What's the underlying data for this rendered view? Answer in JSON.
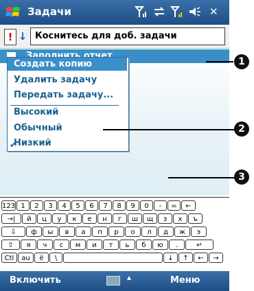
{
  "header": {
    "title": "Задачи",
    "signal_icon": "signal-icon",
    "sync_icon": "sync-icon",
    "volume_icon": "speaker-icon",
    "close_label": "✕"
  },
  "entry": {
    "priority_high": "!",
    "priority_low": "↓",
    "placeholder": "Коснитесь для доб. задачи"
  },
  "task": {
    "title": "Заполнить отчет"
  },
  "context_menu": {
    "items": [
      "Создать копию",
      "Удалить задачу",
      "Передать задачу..."
    ],
    "priorities": [
      "Высокий",
      "Обычный",
      "Низкий"
    ],
    "selected_priority": "Низкий"
  },
  "callouts": [
    "1",
    "2",
    "3"
  ],
  "keyboard": {
    "row1": [
      "123",
      "1",
      "2",
      "3",
      "4",
      "5",
      "6",
      "7",
      "8",
      "9",
      "0",
      "-",
      "=",
      "←"
    ],
    "row2": [
      "→|",
      "й",
      "ц",
      "у",
      "к",
      "е",
      "н",
      "г",
      "ш",
      "щ",
      "з",
      "х",
      "ъ"
    ],
    "row3": [
      "⇩",
      "ф",
      "ы",
      "в",
      "а",
      "п",
      "р",
      "о",
      "л",
      "д",
      "ж",
      "э"
    ],
    "row4": [
      "⇧",
      "я",
      "ч",
      "с",
      "м",
      "и",
      "т",
      "ь",
      "б",
      "ю",
      ".",
      "↵"
    ],
    "row5": [
      "Ctl",
      "аu",
      "ё",
      "\\",
      "",
      "↓",
      "↑",
      "←",
      "→"
    ]
  },
  "bottom": {
    "left": "Включить",
    "right": "Меню"
  },
  "colors": {
    "titlebar": "#1e4f85",
    "selection": "#3a8fc8",
    "menu_text": "#1a6090"
  }
}
